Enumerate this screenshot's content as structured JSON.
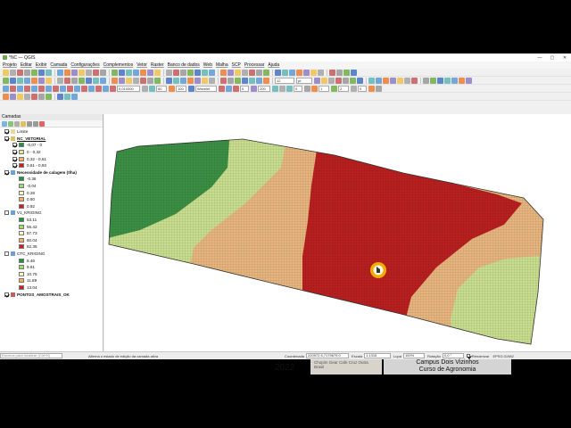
{
  "window": {
    "title": "*NC — QGIS",
    "controls": [
      "—",
      "▢",
      "✕"
    ]
  },
  "menu": [
    "Projeto",
    "Editar",
    "Exibir",
    "Camada",
    "Configurações",
    "Complementos",
    "Vetor",
    "Raster",
    "Banco de dados",
    "Web",
    "Malha",
    "SCP",
    "Processar",
    "Ajuda"
  ],
  "toolbar": {
    "font_size": "12",
    "font_unit": "pt",
    "scale_a": "0,010000",
    "scale_b": "60",
    "scale_c": "100",
    "mode": "Wavelet",
    "val_a": "0",
    "val_b": "200",
    "val_c": "0",
    "val_d": "1",
    "val_e": "2",
    "val_f": "0"
  },
  "panel": {
    "title": "Camadas",
    "layers": [
      {
        "label": "Limite",
        "checked": true,
        "type": "vector-poly",
        "indent": 0
      },
      {
        "label": "NC_VETORIAL",
        "checked": true,
        "type": "group",
        "indent": 0,
        "bold": true,
        "underline": true
      },
      {
        "label": "-0,07 - 0",
        "checked": true,
        "swatch": "#1a9641",
        "indent": 1
      },
      {
        "label": "0 - 0,32",
        "checked": true,
        "swatch": "#d9ef8b",
        "indent": 1
      },
      {
        "label": "0,32 - 0,61",
        "checked": true,
        "swatch": "#fdae61",
        "indent": 1
      },
      {
        "label": "0,61 - 0,93",
        "checked": true,
        "swatch": "#d7191c",
        "indent": 1
      },
      {
        "label": "Necessidade de calagem (t/ha)",
        "checked": true,
        "type": "raster",
        "indent": 0,
        "bold": true
      },
      {
        "label": "-0.36",
        "swatch": "#1a9641",
        "indent": 1
      },
      {
        "label": "-0.04",
        "swatch": "#a6d96a",
        "indent": 1
      },
      {
        "label": "0.28",
        "swatch": "#ffffbf",
        "indent": 1
      },
      {
        "label": "0.60",
        "swatch": "#fdae61",
        "indent": 1
      },
      {
        "label": "0.92",
        "swatch": "#d7191c",
        "indent": 1
      },
      {
        "label": "V1_KRIGING",
        "checked": false,
        "type": "raster",
        "indent": 0
      },
      {
        "label": "53.11",
        "swatch": "#1a9641",
        "indent": 1
      },
      {
        "label": "55.42",
        "swatch": "#a6d96a",
        "indent": 1
      },
      {
        "label": "57.73",
        "swatch": "#ffffbf",
        "indent": 1
      },
      {
        "label": "60.04",
        "swatch": "#fdae61",
        "indent": 1
      },
      {
        "label": "62.35",
        "swatch": "#d7191c",
        "indent": 1
      },
      {
        "label": "CTC_KRIGING",
        "checked": false,
        "type": "raster",
        "indent": 0
      },
      {
        "label": "8.46",
        "swatch": "#1a9641",
        "indent": 1
      },
      {
        "label": "9.61",
        "swatch": "#a6d96a",
        "indent": 1
      },
      {
        "label": "10.75",
        "swatch": "#ffffbf",
        "indent": 1
      },
      {
        "label": "11.89",
        "swatch": "#fdae61",
        "indent": 1
      },
      {
        "label": "13.04",
        "swatch": "#d7191c",
        "indent": 1
      },
      {
        "label": "PONTOS_AMOSTRAIS_OK",
        "checked": true,
        "type": "point",
        "indent": 0,
        "bold": true
      }
    ]
  },
  "status": {
    "locator_placeholder": "Escreva para localizar (Ctrl+K)",
    "message": "Alterna o estado de edição da camada ativa",
    "coord_label": "Coordenada",
    "coord_value": "220972.5,7179679.0",
    "scale_label": "Escala",
    "scale_value": "1:1315",
    "lupa_label": "Lupa",
    "lupa_value": "100%",
    "rot_label": "Rotação",
    "rot_value": "0,0 °",
    "render_label": "Renderizar",
    "crs": "EPSG:31982"
  },
  "colors": {
    "dark_green": "#3a8f43",
    "light_green": "#c8dd8e",
    "tan": "#e6b57d",
    "red": "#b8201f",
    "cursor": "#f4b400"
  },
  "footer": {
    "year": "2022",
    "map_text": "Chopim  Gear  Cafe  Cruz  Outra  Brasil",
    "banner_line1": "Campus Dois Vizinhos",
    "banner_line2": "Curso de Agronomia"
  }
}
